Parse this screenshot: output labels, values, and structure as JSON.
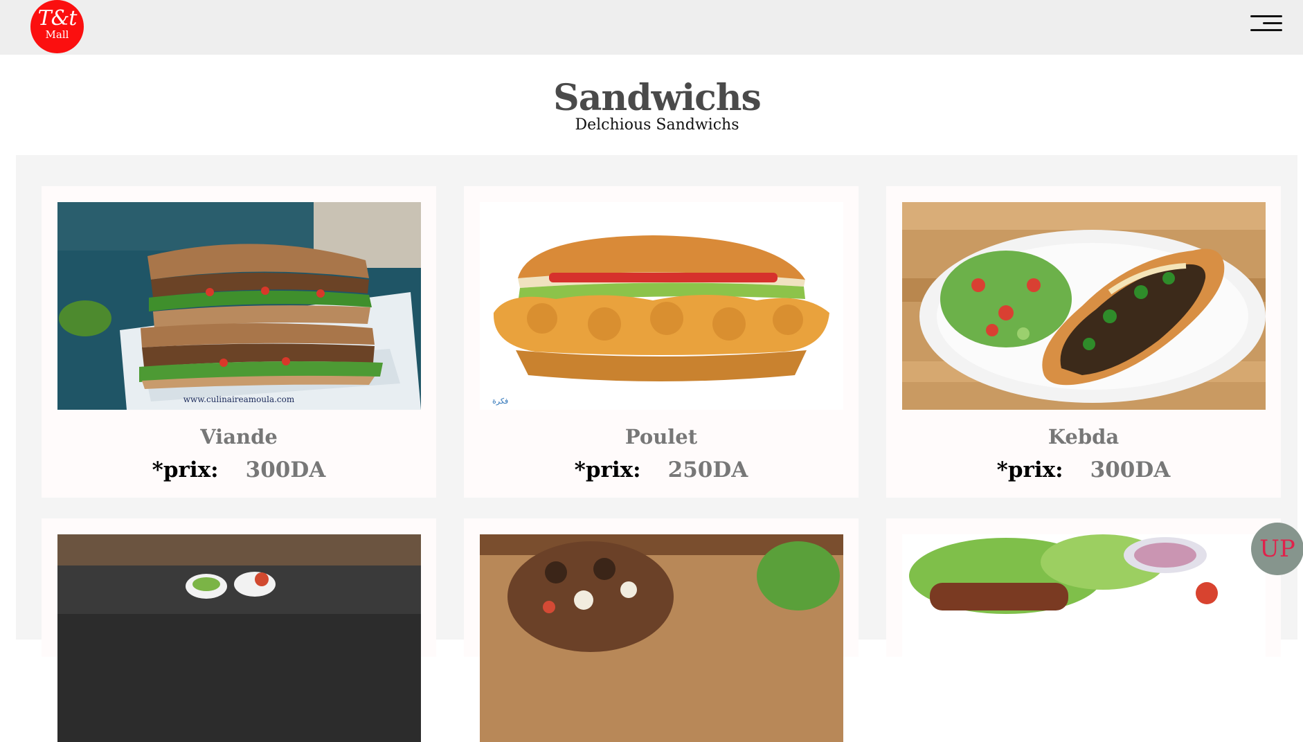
{
  "header": {
    "logo_mark": "T&t",
    "logo_sub": "Mall",
    "menu_icon": "hamburger-icon"
  },
  "section": {
    "title": "Sandwichs",
    "subtitle": "Delchious Sandwichs"
  },
  "products": [
    {
      "name": "Viande",
      "price_label": "*prix:",
      "price": "300DA",
      "image_caption": "www.culinaireamoula.com"
    },
    {
      "name": "Poulet",
      "price_label": "*prix:",
      "price": "250DA",
      "image_caption": "فكرة"
    },
    {
      "name": "Kebda",
      "price_label": "*prix:",
      "price": "300DA"
    }
  ],
  "scroll_top": {
    "label": "UP"
  },
  "colors": {
    "header_bg": "#eeeeee",
    "logo_red": "#fb0f0f",
    "panel_bg": "#f4f4f4",
    "card_bg": "#fffbfb",
    "up_button_bg": "#86958d",
    "up_button_text": "#e0224b"
  }
}
